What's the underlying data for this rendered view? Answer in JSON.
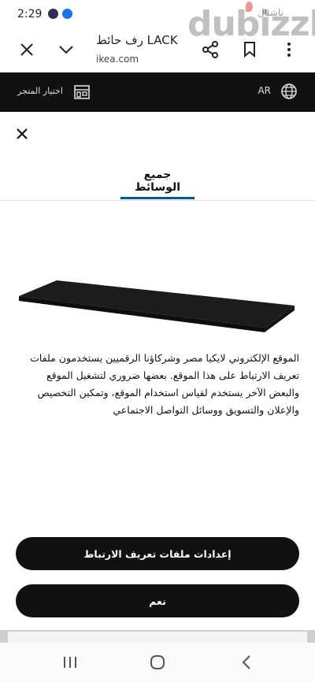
{
  "status_bar": {
    "time": "2:29",
    "right_text": "ناشنال"
  },
  "watermark": {
    "text": "dubizzle"
  },
  "tab_bar": {
    "title": "رف حائط LACK",
    "url": "ikea.com"
  },
  "ikea_bar": {
    "language": "AR",
    "store_label": "اختيار المتجر"
  },
  "sheet": {
    "active_tab": "جميع الوسائط"
  },
  "cookie": {
    "text": "الموقع الإلكتروني لايكيا مصر وشركاؤنا الرقميين يستخدمون ملفات تعريف الارتباط على هذا الموقع. بعضها ضروري لتشغيل الموقع والبعض الآخر يستخدم لقياس استخدام الموقع، وتمكين التخصيص والإعلان والتسويق ووسائل التواصل الاجتماعي",
    "settings_button": "إعدادات ملفات تعريف الارتباط",
    "accept_button": "نعم"
  },
  "colors": {
    "ikea_bar": "#111111",
    "tab_underline": "#0058a3",
    "button": "#111111",
    "shelf": "#1c1c1c"
  },
  "icons": [
    "close-icon",
    "chevron-down-icon",
    "share-icon",
    "bookmark-icon",
    "more-vert-icon",
    "globe-icon",
    "store-icon",
    "recent-apps-icon",
    "home-icon",
    "back-icon"
  ]
}
